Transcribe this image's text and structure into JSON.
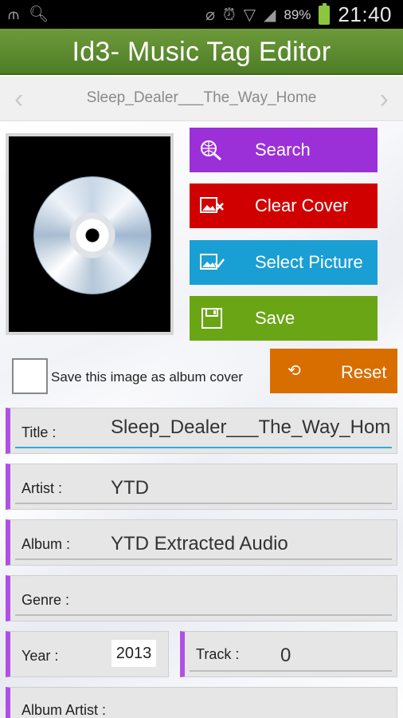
{
  "status_bar": {
    "icons": [
      "usb-icon",
      "search-icon",
      "wifi-off-icon",
      "alarm-icon",
      "wifi-icon",
      "signal-icon",
      "battery-charging-icon"
    ],
    "battery_percent": "89%",
    "time": "21:40"
  },
  "app": {
    "title": "Id3- Music Tag Editor"
  },
  "nav": {
    "current_file": "Sleep_Dealer___The_Way_Home"
  },
  "buttons": {
    "search": "Search",
    "clear_cover": "Clear Cover",
    "select_picture": "Select Picture",
    "save": "Save",
    "reset": "Reset"
  },
  "checkbox": {
    "label": "Save this image as album cover",
    "checked": false
  },
  "fields": {
    "title": {
      "label": "Title :",
      "value": "Sleep_Dealer___The_Way_Hom"
    },
    "artist": {
      "label": "Artist :",
      "value": "YTD"
    },
    "album": {
      "label": "Album :",
      "value": "YTD Extracted Audio"
    },
    "genre": {
      "label": "Genre :",
      "value": ""
    },
    "year": {
      "label": "Year :",
      "value": "2013"
    },
    "track": {
      "label": "Track :",
      "value": "0"
    },
    "album_artist": {
      "label": "Album Artist :",
      "value": ""
    }
  },
  "colors": {
    "title_bar": "#5a8a2e",
    "search": "#9b30d9",
    "clear_cover": "#d10000",
    "select_picture": "#1a9fd4",
    "save": "#6aa515",
    "reset": "#d86e00",
    "field_accent": "#b04fe6"
  }
}
